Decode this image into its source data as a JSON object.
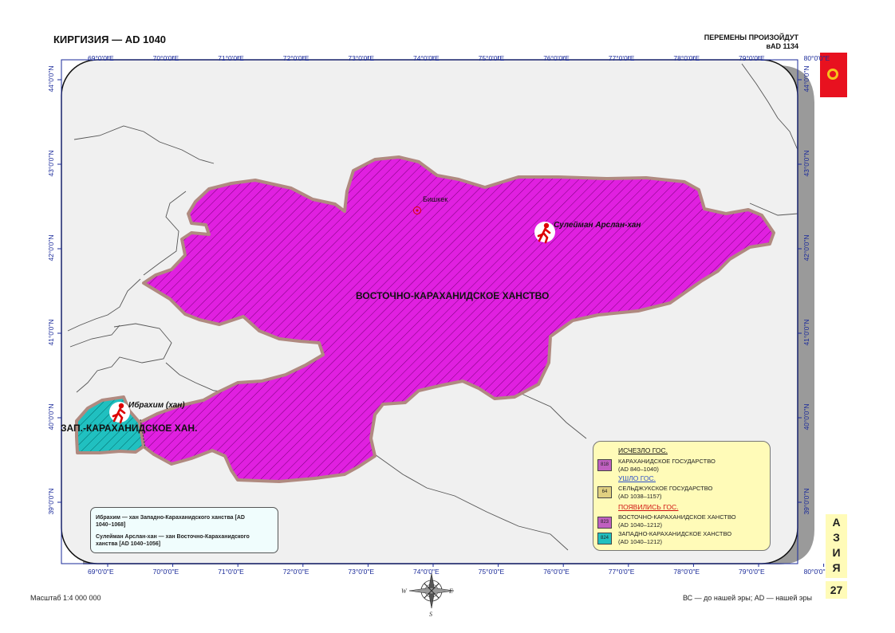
{
  "header": {
    "title": "КИРГИЗИЯ — AD 1040",
    "changes_line1": "ПЕРЕМЕНЫ ПРОИЗОЙДУТ",
    "changes_line2": "вAD 1134"
  },
  "lon_ticks": [
    "69°0'0\"E",
    "70°0'0\"E",
    "71°0'0\"E",
    "72°0'0\"E",
    "73°0'0\"E",
    "74°0'0\"E",
    "75°0'0\"E",
    "76°0'0\"E",
    "77°0'0\"E",
    "78°0'0\"E",
    "79°0'0\"E",
    "80°0'0\"E"
  ],
  "lat_ticks": [
    "44°0'0\"N",
    "43°0'0\"N",
    "42°0'0\"N",
    "41°0'0\"N",
    "40°0'0\"N",
    "39°0'0\"N"
  ],
  "labels": {
    "east_khanate": "ВОСТОЧНО-КАРАХАНИДСКОЕ ХАНСТВО",
    "west_khanate": "ЗАП.-КАРАХАНИДСКОЕ ХАН.",
    "capital": "Бишкек",
    "ruler_east": "Сулейман Арслан-хан",
    "ruler_west": "Ибрахим (хан)"
  },
  "colors": {
    "east": "#e020e0",
    "west": "#20c0c0",
    "karakhanid": "#c060c0",
    "seljuk": "#e0d080",
    "legend_bg": "#fffbb8"
  },
  "legend": {
    "gone_title": "ИСЧЕЗЛО ГОС.",
    "gone_items": [
      {
        "code": "818",
        "name": "КАРАХАНИДСКОЕ ГОСУДАРСТВО",
        "years": "(AD 840–1040)"
      }
    ],
    "left_title": "УШЛО ГОС.",
    "left_items": [
      {
        "code": "64",
        "name": "СЕЛЬДЖУКСКОЕ ГОСУДАРСТВО",
        "years": "(AD 1038–1157)"
      }
    ],
    "new_title": "ПОЯВИЛИСЬ ГОС.",
    "new_items": [
      {
        "code": "823",
        "name": "ВОСТОЧНО-КАРАХАНИДСКОЕ ХАНСТВО",
        "years": "(AD 1040–1212)"
      },
      {
        "code": "824",
        "name": "ЗАПАДНО-КАРАХАНИДСКОЕ ХАНСТВО",
        "years": "(AD 1040–1212)"
      }
    ]
  },
  "notes": {
    "note1": "Ибрахим — хан Западно-Караханидского ханства [AD 1040–1068]",
    "note2": "Сулейман Арслан-хан — хан Восточно-Караханидского ханства [AD 1040–1056]"
  },
  "side": {
    "letters": [
      "А",
      "З",
      "И",
      "Я"
    ],
    "page": "27"
  },
  "footer": {
    "scale": "Масштаб 1:4 000 000",
    "era": "ВС — до нашей эры; AD — нашей эры"
  }
}
